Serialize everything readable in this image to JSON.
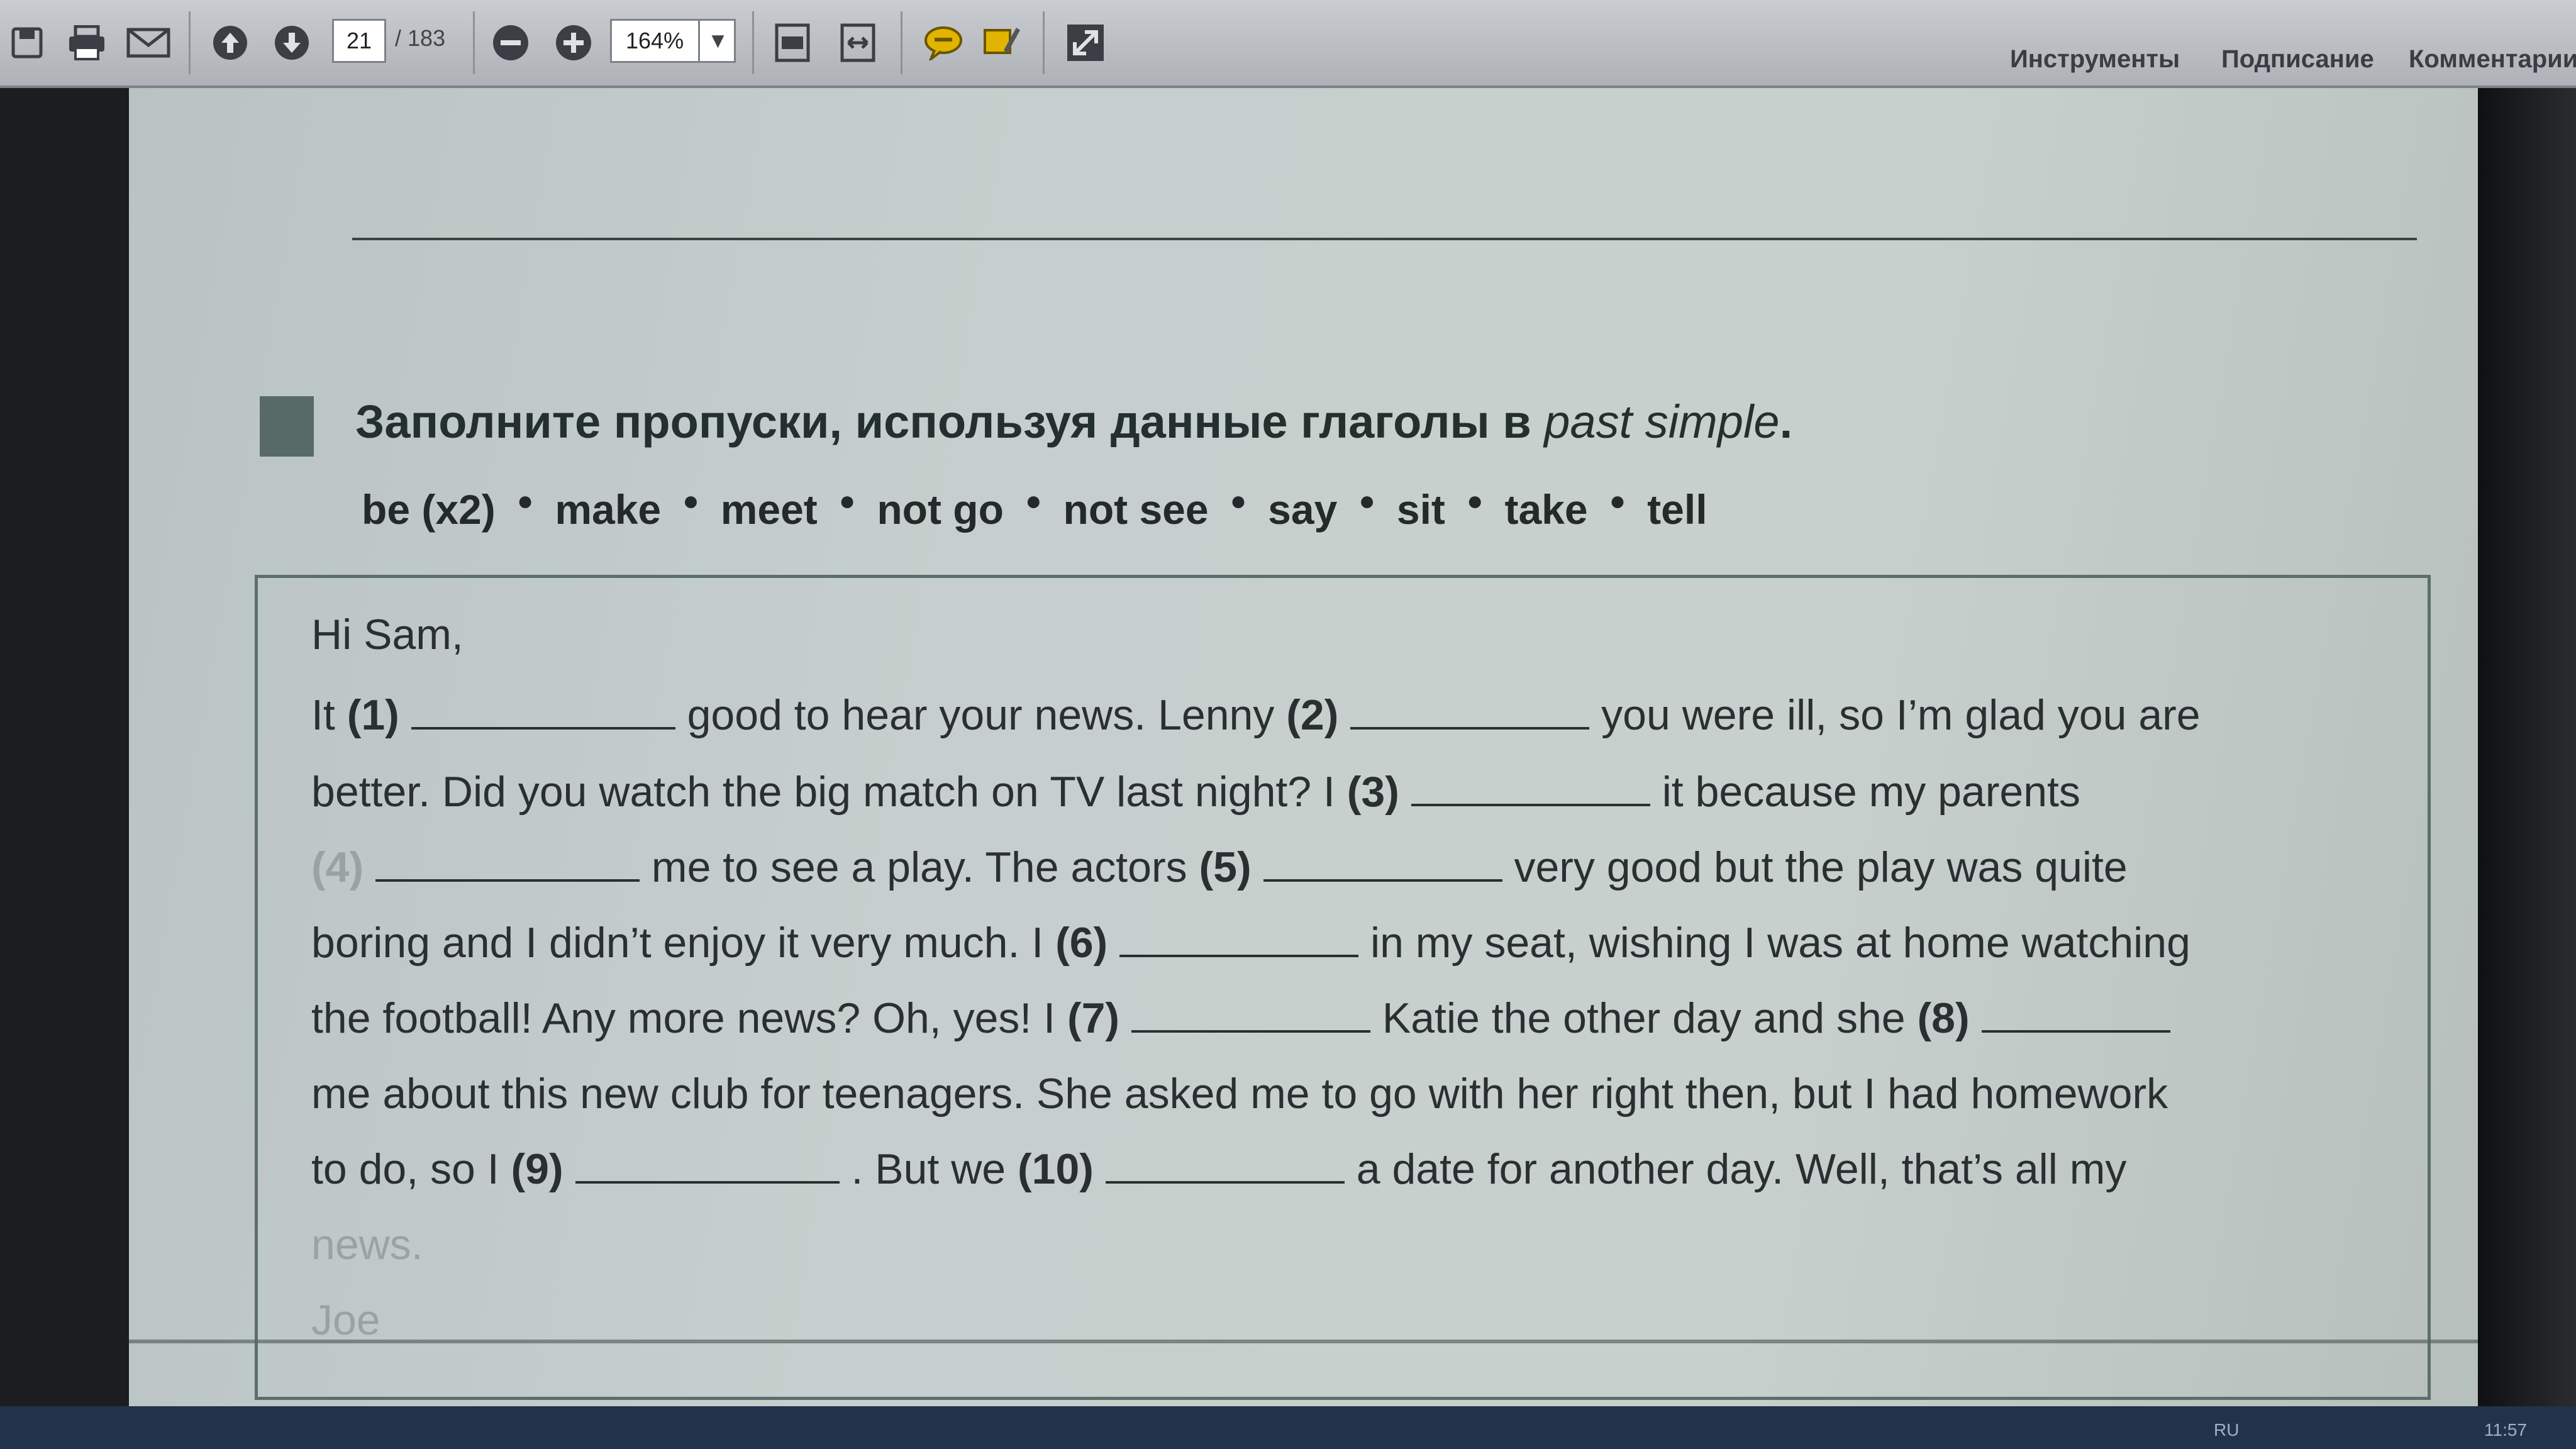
{
  "toolbar": {
    "page_current": "21",
    "page_total": "/ 183",
    "zoom": "164%",
    "icons": [
      "save-icon",
      "print-icon",
      "mail-icon",
      "page-up-icon",
      "page-down-icon",
      "zoom-out-icon",
      "zoom-in-icon",
      "fit-page-icon",
      "fit-width-icon",
      "comment-icon",
      "highlight-icon",
      "expand-icon"
    ],
    "panels": [
      "Инструменты",
      "Подписание",
      "Комментарии"
    ]
  },
  "document": {
    "instruction_main": "Заполните пропуски, используя данные глаголы в ",
    "instruction_italic": "past simple",
    "instruction_end": ".",
    "verbs": [
      "be (x2)",
      "make",
      "meet",
      "not go",
      "not see",
      "say",
      "sit",
      "take",
      "tell"
    ],
    "letter": {
      "greeting": "Hi Sam,",
      "l1": {
        "a": "It ",
        "n1": "(1)",
        "b": " good to hear your news. Lenny ",
        "n2": "(2)",
        "c": " you were ill, so I’m glad you are"
      },
      "l2": {
        "a": "better. Did you watch the big match on TV last night? I ",
        "n3": "(3)",
        "b": " it because my parents"
      },
      "l3": {
        "n4": "(4)",
        "a": " me to see a play. The actors ",
        "n5": "(5)",
        "b": " very good but the play was quite"
      },
      "l4": {
        "a": "boring and I didn’t enjoy it very much. I ",
        "n6": "(6)",
        "b": " in my seat, wishing I was at home watching"
      },
      "l5": {
        "a": "the football! Any more news? Oh, yes! I ",
        "n7": "(7)",
        "b": " Katie the other day and she ",
        "n8": "(8)"
      },
      "l6": {
        "a": "me about this new club for teenagers. She asked me to go with her right then, but I had homework"
      },
      "l7": {
        "a": "to do, so I ",
        "n9": "(9)",
        "b": ". But we ",
        "n10": "(10)",
        "c": " a date for another day. Well, that’s all my"
      },
      "l8": "news.",
      "signoff": "Joe"
    }
  },
  "taskbar": {
    "lang": "RU",
    "time": "11:57"
  }
}
